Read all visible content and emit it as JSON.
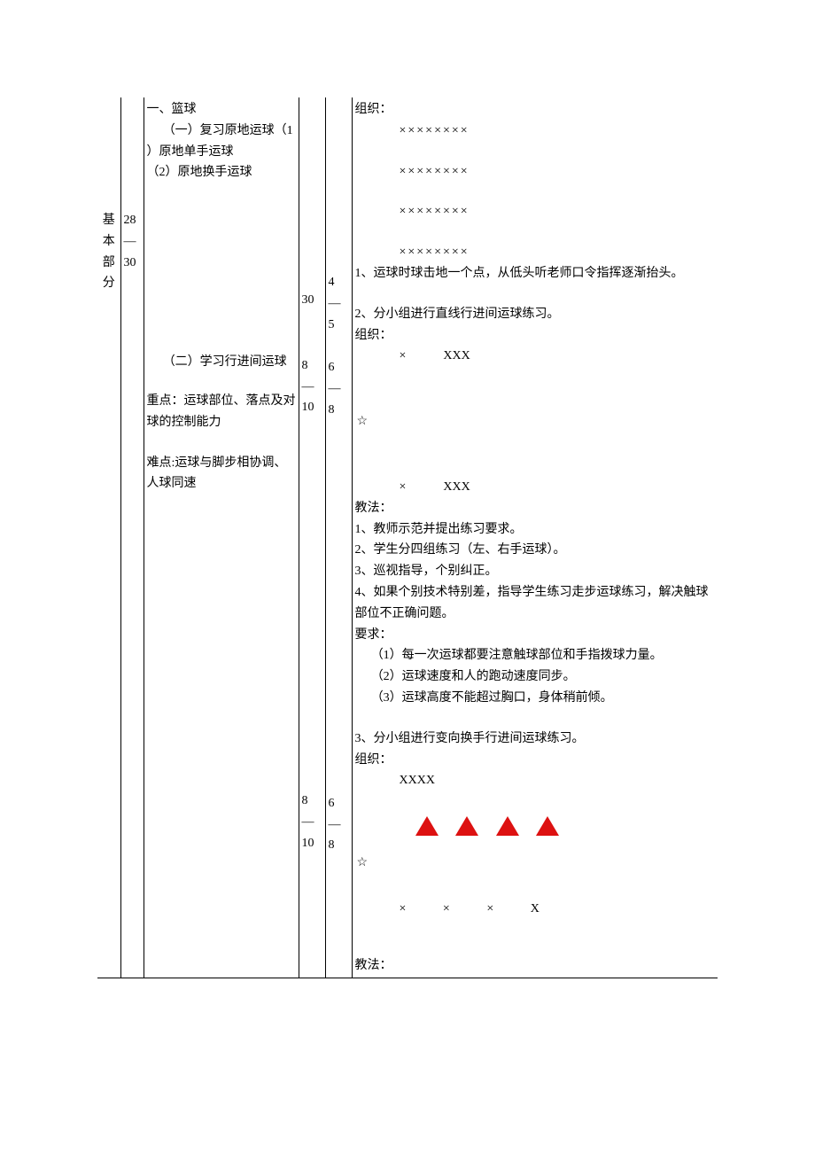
{
  "section_label": "基\n本\n部\n分",
  "time_range": "28\n—\n30",
  "content": {
    "heading": "一、篮球",
    "sub1_title": "（一）复习原地运球（1",
    "sub1_item1": "）原地单手运球",
    "sub1_item2": "（2）原地换手运球",
    "sub2_title": "（二）学习行进间运球",
    "key_point": "重点：运球部位、落点及对球的控制能力",
    "difficulty": "难点:运球与脚步相协调、人球同速"
  },
  "dur": {
    "a": "30",
    "b": "8\n—\n10",
    "c": "8\n—\n10"
  },
  "reps": {
    "a": "4\n—\n5",
    "b": "6\n—\n8",
    "c": "6\n—\n8"
  },
  "org": {
    "label": "组织：",
    "x_row": "××××××××",
    "note1": "1、运球时球击地一个点，从低头听老师口令指挥逐渐抬头。",
    "note2": "2、分小组进行直线行进间运球练习。",
    "formation_line": "×　　　XXX",
    "star": "☆",
    "method_label": "教法：",
    "m1": "1、教师示范并提出练习要求。",
    "m2": "2、学生分四组练习（左、右手运球）。",
    "m3": "3、巡视指导，个别纠正。",
    "m4": "4、如果个别技术特别差，指导学生练习走步运球练习，解决触球部位不正确问题。",
    "req_label": "要求：",
    "r1": "（1）每一次运球都要注意触球部位和手指拨球力量。",
    "r2": "（2）运球速度和人的跑动速度同步。",
    "r3": "（3）运球高度不能超过胸口，身体稍前倾。",
    "note3": "3、分小组进行变向换手行进间运球练习。",
    "xxxx": "XXXX",
    "spaced": [
      "×",
      "×",
      "×",
      "X"
    ],
    "method_label2": "教法："
  }
}
